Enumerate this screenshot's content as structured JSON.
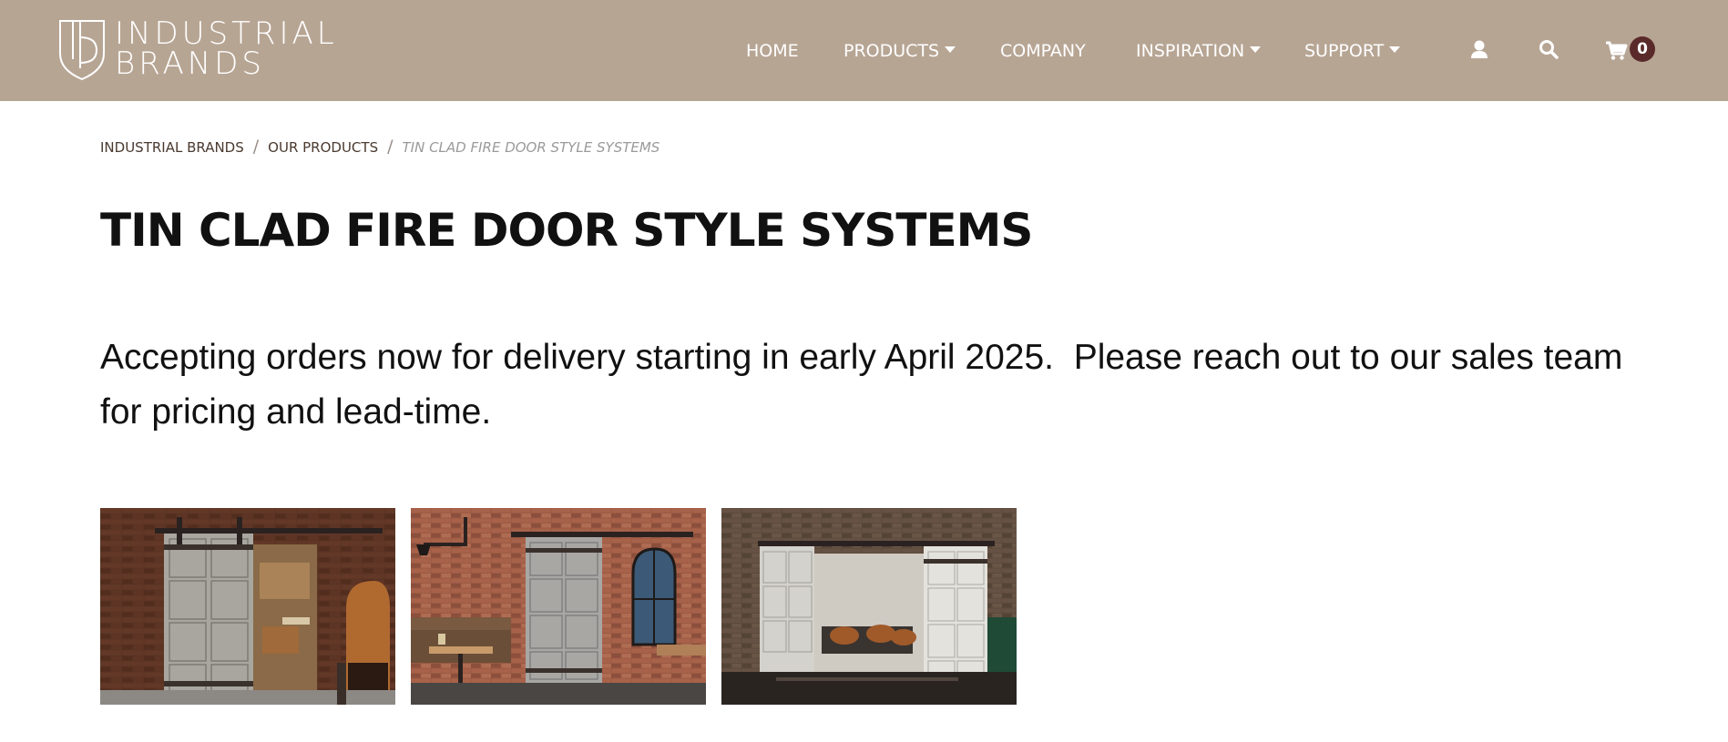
{
  "brand": {
    "line1": "INDUSTRIAL",
    "line2": "BRANDS",
    "logo_icon": "ib-shield-logo"
  },
  "nav": {
    "items": [
      {
        "label": "HOME",
        "has_dropdown": false
      },
      {
        "label": "PRODUCTS",
        "has_dropdown": true
      },
      {
        "label": "COMPANY",
        "has_dropdown": false
      },
      {
        "label": "INSPIRATION",
        "has_dropdown": true
      },
      {
        "label": "SUPPORT",
        "has_dropdown": true
      }
    ],
    "icons": [
      "user-icon",
      "search-icon",
      "cart-icon"
    ],
    "cart_count": "0"
  },
  "breadcrumb": {
    "items": [
      "INDUSTRIAL BRANDS",
      "OUR PRODUCTS"
    ],
    "current": "TIN CLAD FIRE DOOR STYLE SYSTEMS",
    "separator": "/"
  },
  "page": {
    "title": "TIN CLAD FIRE DOOR STYLE SYSTEMS",
    "notice": "Accepting orders now for delivery starting in early April 2025.  Please reach out to our sales team for pricing and lead-time."
  },
  "colors": {
    "header_bg": "#b7a594",
    "badge_bg": "#5a2a2a",
    "text": "#111111"
  },
  "gallery": {
    "count": 3
  }
}
